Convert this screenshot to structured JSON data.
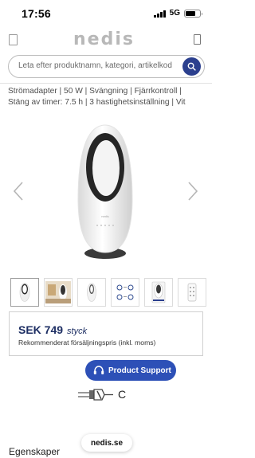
{
  "status_bar": {
    "time": "17:56",
    "network": "5G",
    "signal_bars": 4,
    "battery_level": 0.7
  },
  "header": {
    "logo": "nedis",
    "menu_icon": "menu-icon",
    "cart_icon": "cart-icon"
  },
  "search": {
    "placeholder": "Leta efter produktnamn, kategori, artikelkod",
    "value": "",
    "button_icon": "search-icon"
  },
  "product": {
    "description_line1": "Strömadapter | 50 W | Svängning | Fjärrkontroll |",
    "description_line2": "Stäng av timer: 7.5 h | 3 hastighetsinställning | Vit",
    "image_icon": "bladeless-fan-image",
    "prev_icon": "chevron-left-icon",
    "next_icon": "chevron-right-icon"
  },
  "thumbnails": [
    {
      "icon": "fan-front-thumbnail",
      "active": true
    },
    {
      "icon": "lifestyle-photo-thumbnail",
      "active": false
    },
    {
      "icon": "fan-side-thumbnail",
      "active": false
    },
    {
      "icon": "feature-icons-thumbnail",
      "active": false
    },
    {
      "icon": "fan-packaging-thumbnail",
      "active": false
    },
    {
      "icon": "remote-control-thumbnail",
      "active": false
    }
  ],
  "price": {
    "amount": "SEK 749",
    "unit": "styck",
    "note": "Rekommenderat försäljningspris (inkl. moms)"
  },
  "support_button": {
    "label": "Product Support",
    "icon": "headset-icon"
  },
  "energy_class": {
    "label": "C",
    "icon": "power-plug-icon"
  },
  "url_pill": {
    "text": "nedis.se"
  },
  "section": {
    "heading": "Egenskaper"
  },
  "colors": {
    "brand_blue": "#2b3f8e",
    "support_blue": "#2d50b7",
    "price_text": "#1d2e63"
  }
}
